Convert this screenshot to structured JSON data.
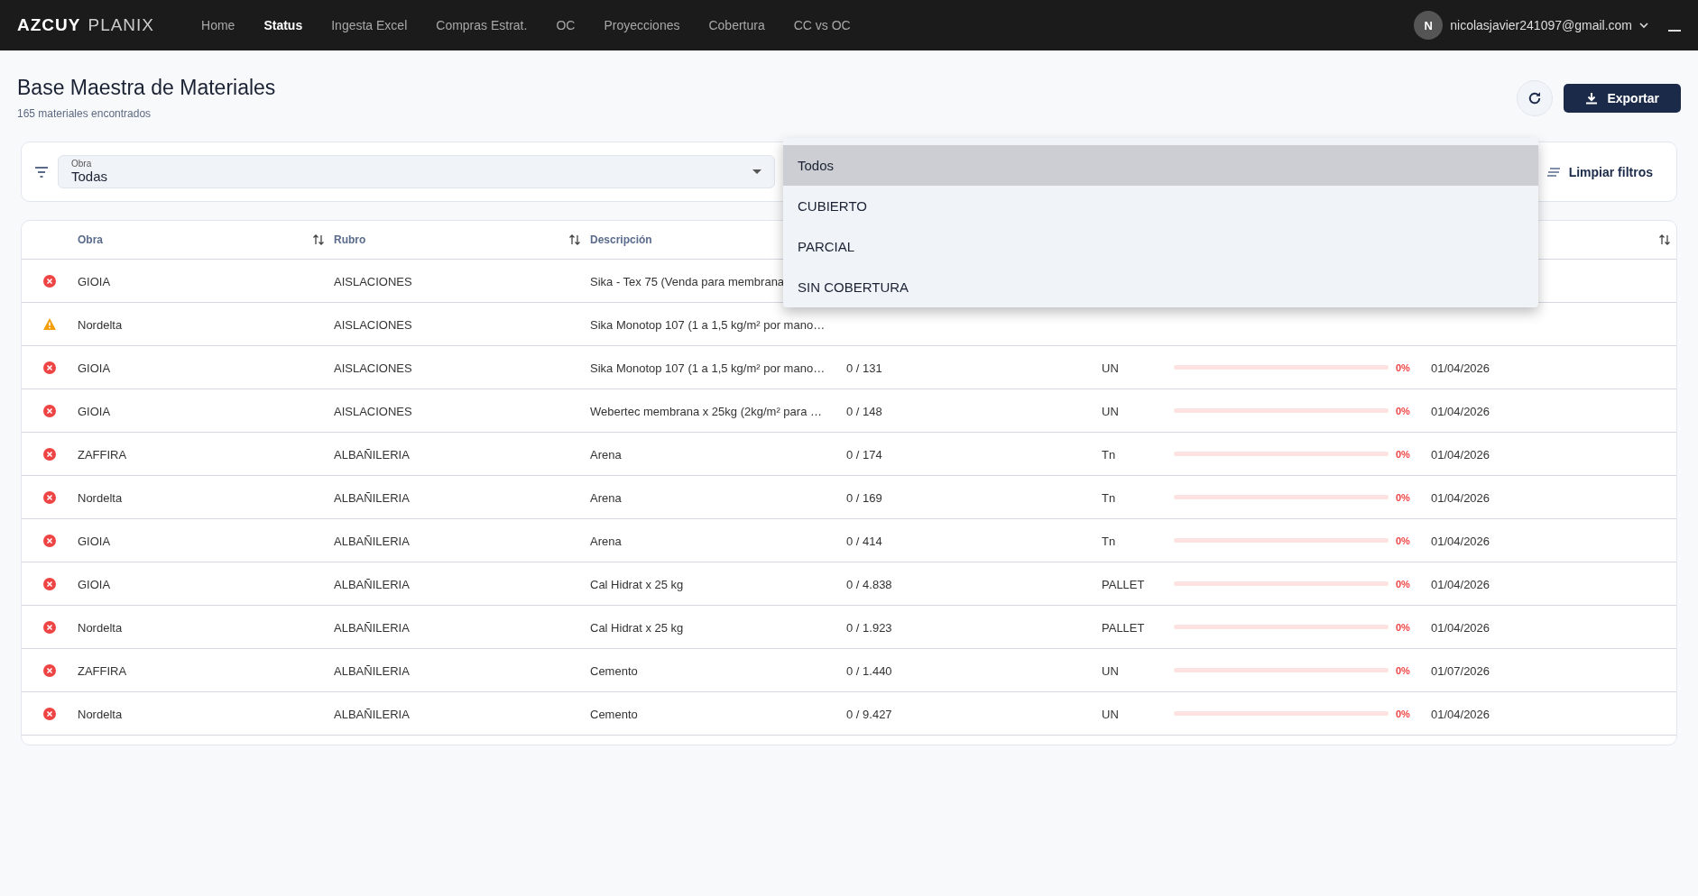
{
  "navbar": {
    "brand_bold": "AZCUY",
    "brand_light": "PLANIX",
    "links": [
      {
        "label": "Home",
        "selected": false
      },
      {
        "label": "Status",
        "selected": true
      },
      {
        "label": "Ingesta Excel",
        "selected": false
      },
      {
        "label": "Compras Estrat.",
        "selected": false
      },
      {
        "label": "OC",
        "selected": false
      },
      {
        "label": "Proyecciones",
        "selected": false
      },
      {
        "label": "Cobertura",
        "selected": false
      },
      {
        "label": "CC vs OC",
        "selected": false
      }
    ],
    "user": {
      "initial": "N",
      "email": "nicolasjavier241097@gmail.com"
    }
  },
  "header": {
    "title": "Base Maestra de Materiales",
    "subtitle": "165 materiales encontrados",
    "export_label": "Exportar"
  },
  "filters": {
    "obra": {
      "label": "Obra",
      "value": "Todas"
    },
    "clear_label": "Limpiar filtros"
  },
  "dropdown": {
    "options": [
      {
        "label": "Todos",
        "selected": true
      },
      {
        "label": "CUBIERTO",
        "selected": false
      },
      {
        "label": "PARCIAL",
        "selected": false
      },
      {
        "label": "SIN COBERTURA",
        "selected": false
      }
    ]
  },
  "table": {
    "columns": [
      "Obra",
      "Rubro",
      "Descripción"
    ],
    "rows": [
      {
        "kind": "error",
        "obra": "GIOIA",
        "rubro": "AISLACIONES",
        "descripcion": "Sika - Tex 75 (Venda para membrana"
      },
      {
        "kind": "warning",
        "obra": "Nordelta",
        "rubro": "AISLACIONES",
        "descripcion": "Sika Monotop 107 (1 a 1,5 kg/m² por mano…"
      },
      {
        "kind": "error",
        "obra": "GIOIA",
        "rubro": "AISLACIONES",
        "descripcion": "Sika Monotop 107 (1 a 1,5 kg/m² por mano…",
        "cantidad": "0  / 131",
        "unidad": "UN",
        "level": 0,
        "porcentaje": "0%",
        "fecha": "01/04/2026"
      },
      {
        "kind": "error",
        "obra": "GIOIA",
        "rubro": "AISLACIONES",
        "descripcion": "Webertec membrana x 25kg (2kg/m² para …",
        "cantidad": "0  / 148",
        "unidad": "UN",
        "level": 0,
        "porcentaje": "0%",
        "fecha": "01/04/2026"
      },
      {
        "kind": "error",
        "obra": "ZAFFIRA",
        "rubro": "ALBAÑILERIA",
        "descripcion": "Arena",
        "cantidad": "0  / 174",
        "unidad": "Tn",
        "level": 0,
        "porcentaje": "0%",
        "fecha": "01/04/2026"
      },
      {
        "kind": "error",
        "obra": "Nordelta",
        "rubro": "ALBAÑILERIA",
        "descripcion": "Arena",
        "cantidad": "0  / 169",
        "unidad": "Tn",
        "level": 0,
        "porcentaje": "0%",
        "fecha": "01/04/2026"
      },
      {
        "kind": "error",
        "obra": "GIOIA",
        "rubro": "ALBAÑILERIA",
        "descripcion": "Arena",
        "cantidad": "0  / 414",
        "unidad": "Tn",
        "level": 0,
        "porcentaje": "0%",
        "fecha": "01/04/2026"
      },
      {
        "kind": "error",
        "obra": "GIOIA",
        "rubro": "ALBAÑILERIA",
        "descripcion": "Cal Hidrat x 25 kg",
        "cantidad": "0  / 4.838",
        "unidad": "PALLET",
        "level": 0,
        "porcentaje": "0%",
        "fecha": "01/04/2026"
      },
      {
        "kind": "error",
        "obra": "Nordelta",
        "rubro": "ALBAÑILERIA",
        "descripcion": "Cal Hidrat x 25 kg",
        "cantidad": "0  / 1.923",
        "unidad": "PALLET",
        "level": 0,
        "porcentaje": "0%",
        "fecha": "01/04/2026"
      },
      {
        "kind": "error",
        "obra": "ZAFFIRA",
        "rubro": "ALBAÑILERIA",
        "descripcion": "Cemento",
        "cantidad": "0  / 1.440",
        "unidad": "UN",
        "level": 0,
        "porcentaje": "0%",
        "fecha": "01/07/2026"
      },
      {
        "kind": "error",
        "obra": "Nordelta",
        "rubro": "ALBAÑILERIA",
        "descripcion": "Cemento",
        "cantidad": "0  / 9.427",
        "unidad": "UN",
        "level": 0,
        "porcentaje": "0%",
        "fecha": "01/04/2026"
      }
    ]
  }
}
